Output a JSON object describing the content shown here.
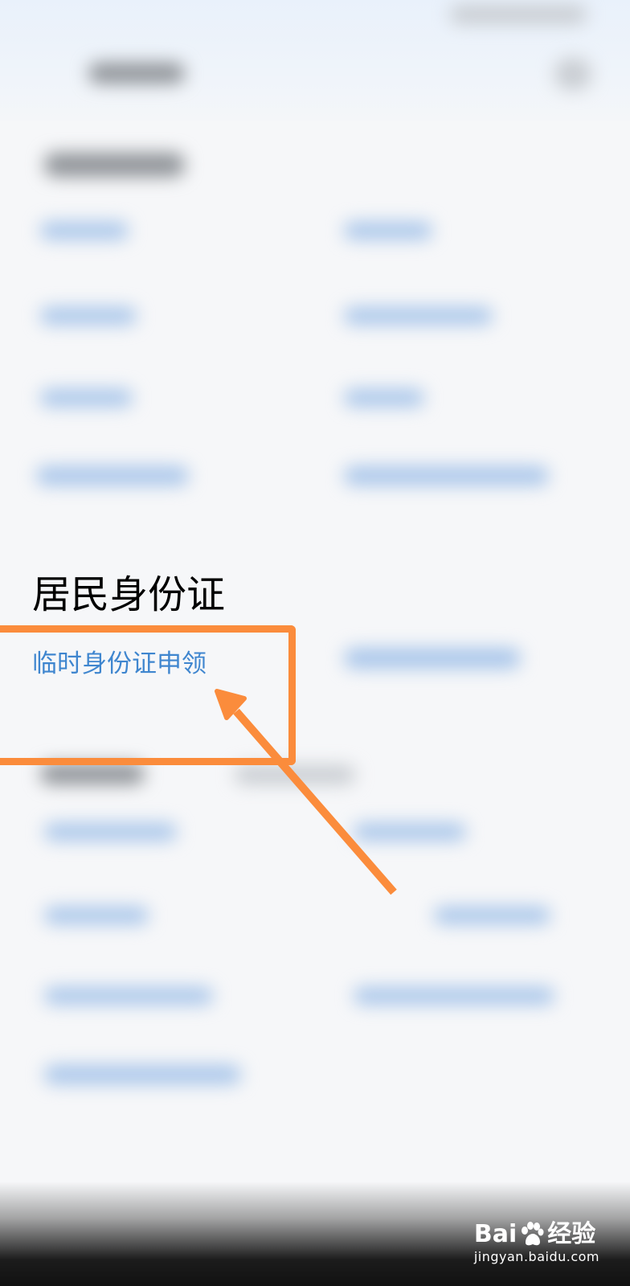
{
  "section": {
    "title": "居民身份证",
    "link_item": "临时身份证申领"
  },
  "watermark": {
    "brand_left": "Bai",
    "brand_right": "经验",
    "url": "jingyan.baidu.com"
  },
  "colors": {
    "link": "#3f86cf",
    "highlight": "#fb8c3c",
    "title": "#000000"
  },
  "icons": [
    "arrow-annotation-icon",
    "baidu-paw-icon"
  ]
}
